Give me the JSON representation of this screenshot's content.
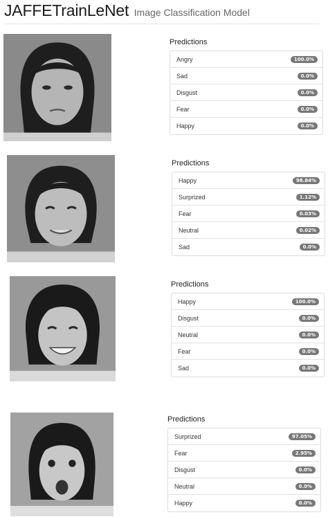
{
  "header": {
    "title": "JAFFETrainLeNet",
    "subtitle": "Image Classification Model"
  },
  "results": [
    {
      "heading": "Predictions",
      "predictions": [
        {
          "label": "Angry",
          "value": "100.0%"
        },
        {
          "label": "Sad",
          "value": "0.0%"
        },
        {
          "label": "Disgust",
          "value": "0.0%"
        },
        {
          "label": "Fear",
          "value": "0.0%"
        },
        {
          "label": "Happy",
          "value": "0.0%"
        }
      ]
    },
    {
      "heading": "Predictions",
      "predictions": [
        {
          "label": "Happy",
          "value": "98.84%"
        },
        {
          "label": "Surprized",
          "value": "1.12%"
        },
        {
          "label": "Fear",
          "value": "0.03%"
        },
        {
          "label": "Neutral",
          "value": "0.02%"
        },
        {
          "label": "Sad",
          "value": "0.0%"
        }
      ]
    },
    {
      "heading": "Predictions",
      "predictions": [
        {
          "label": "Happy",
          "value": "100.0%"
        },
        {
          "label": "Disgust",
          "value": "0.0%"
        },
        {
          "label": "Neutral",
          "value": "0.0%"
        },
        {
          "label": "Fear",
          "value": "0.0%"
        },
        {
          "label": "Sad",
          "value": "0.0%"
        }
      ]
    },
    {
      "heading": "Predictions",
      "predictions": [
        {
          "label": "Surprized",
          "value": "97.05%"
        },
        {
          "label": "Fear",
          "value": "2.95%"
        },
        {
          "label": "Disgust",
          "value": "0.0%"
        },
        {
          "label": "Neutral",
          "value": "0.0%"
        },
        {
          "label": "Happy",
          "value": "0.0%"
        }
      ]
    }
  ]
}
